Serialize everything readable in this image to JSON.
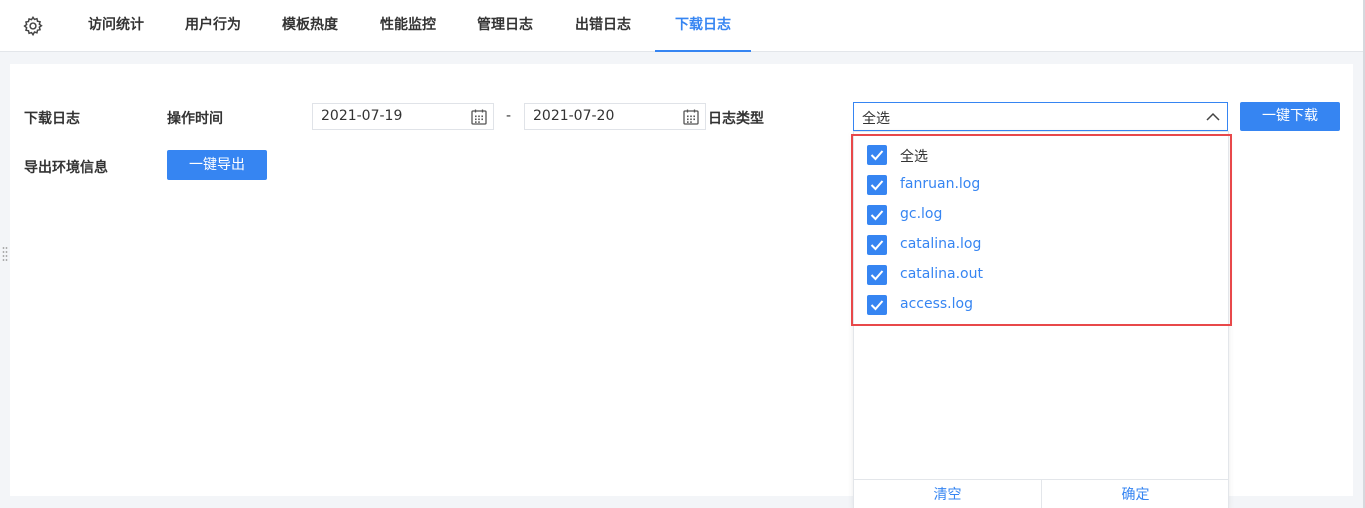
{
  "tabs": [
    {
      "label": "访问统计"
    },
    {
      "label": "用户行为"
    },
    {
      "label": "模板热度"
    },
    {
      "label": "性能监控"
    },
    {
      "label": "管理日志"
    },
    {
      "label": "出错日志"
    },
    {
      "label": "下载日志",
      "active": true
    }
  ],
  "download_section": {
    "title": "下载日志",
    "time_label": "操作时间",
    "start_date": "2021-07-19",
    "separator": "-",
    "end_date": "2021-07-20",
    "type_label": "日志类型",
    "type_value": "全选",
    "download_button": "一键下载"
  },
  "export_section": {
    "title": "导出环境信息",
    "export_button": "一键导出"
  },
  "dropdown": {
    "options": [
      {
        "label": "全选",
        "checked": true
      },
      {
        "label": "fanruan.log",
        "checked": true
      },
      {
        "label": "gc.log",
        "checked": true
      },
      {
        "label": "catalina.log",
        "checked": true
      },
      {
        "label": "catalina.out",
        "checked": true
      },
      {
        "label": "access.log",
        "checked": true
      }
    ],
    "clear_button": "清空",
    "confirm_button": "确定"
  },
  "colors": {
    "accent": "#3685f2",
    "highlight": "#e8484a"
  }
}
